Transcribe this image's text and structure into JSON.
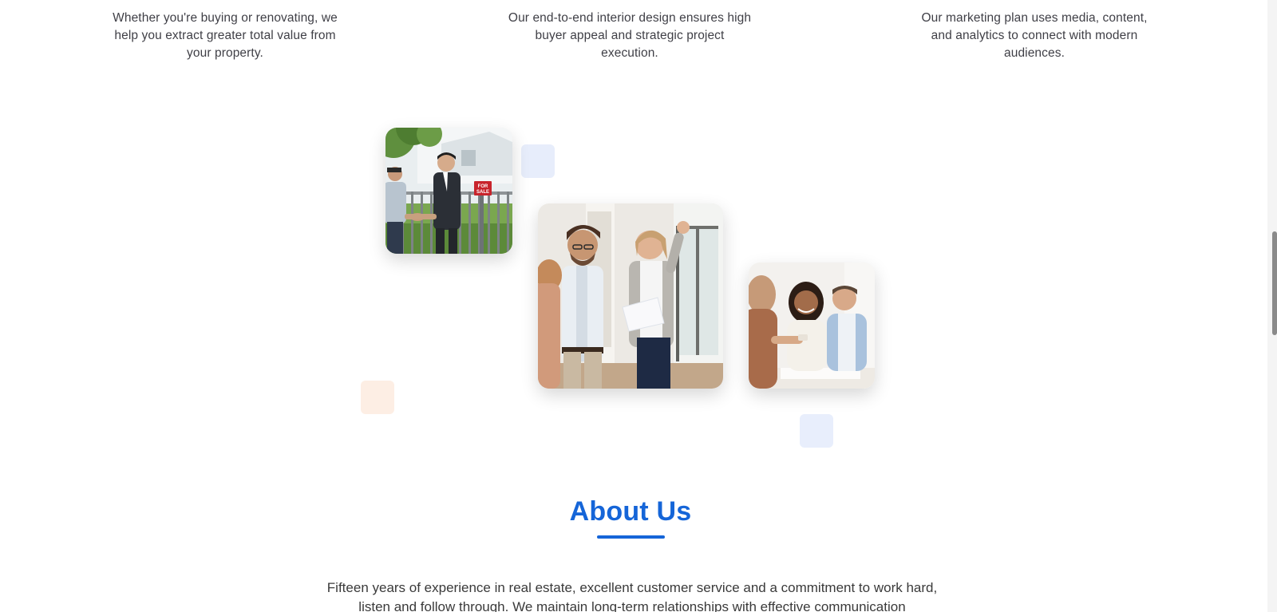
{
  "features": [
    {
      "description": "Whether you're buying or renovating, we help you extract greater total value from your property."
    },
    {
      "description": "Our end-to-end interior design ensures high buyer appeal and strategic project execution."
    },
    {
      "description": "Our marketing plan uses media, content, and analytics to connect with modern audiences."
    }
  ],
  "gallery": {
    "photos": [
      {
        "sign_text_1": "FOR",
        "sign_text_2": "SALE"
      },
      {},
      {}
    ]
  },
  "about": {
    "title": "About Us",
    "body": "Fifteen years of experience in real estate, excellent customer service and a commitment to work hard, listen and follow through. We maintain long-term relationships with effective communication"
  },
  "colors": {
    "accent": "#1565d8",
    "text": "#3f3f46",
    "deco_blue": "#e7edfb",
    "deco_peach": "#fdeee4"
  }
}
